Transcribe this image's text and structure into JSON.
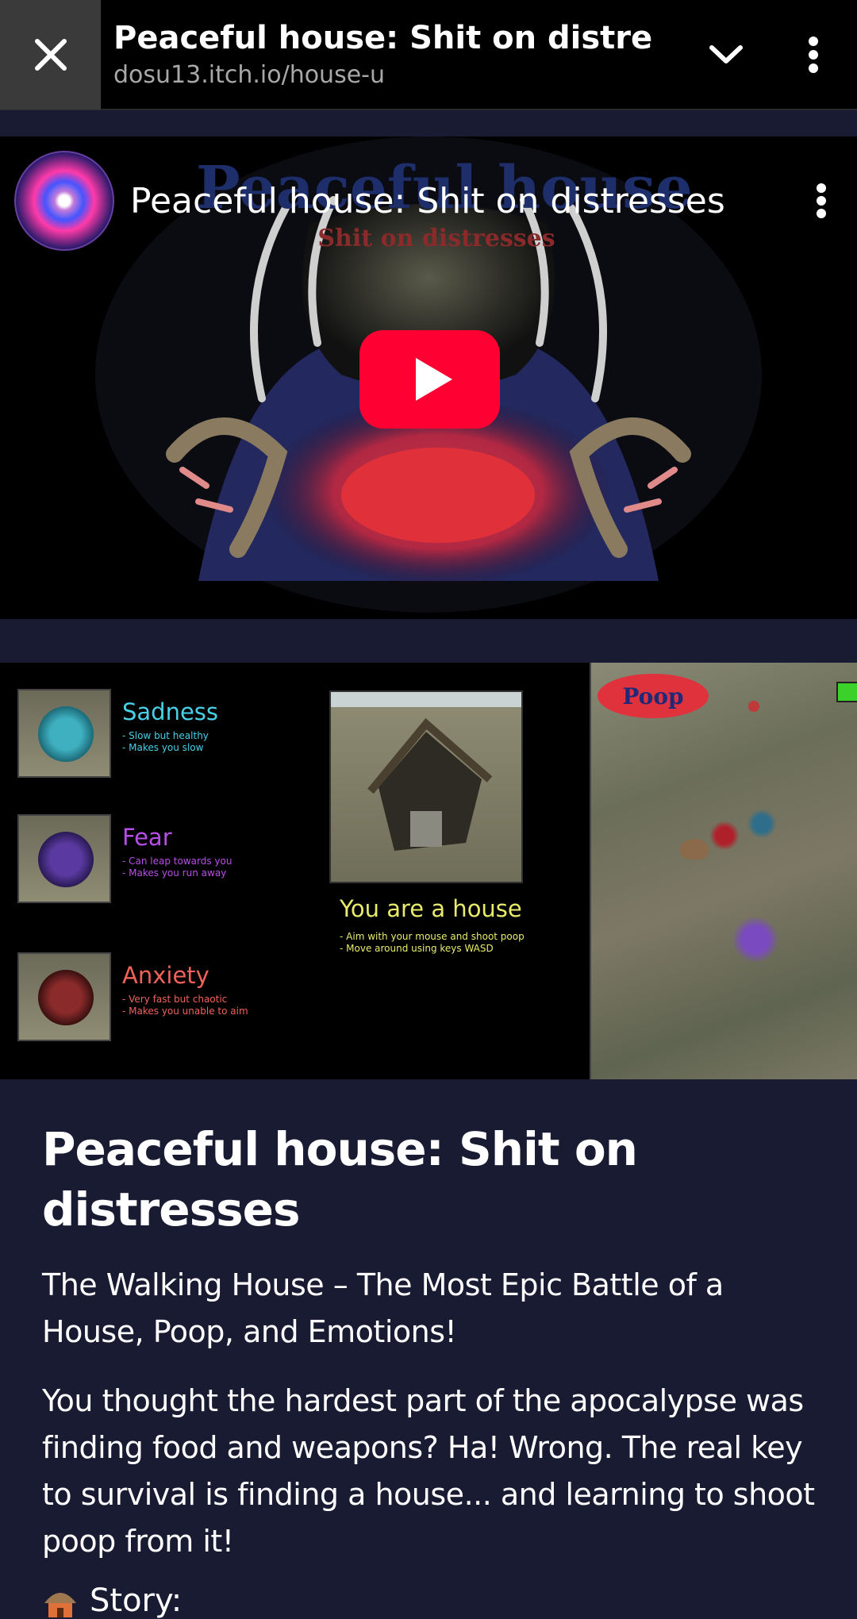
{
  "browser": {
    "title": "Peaceful house: Shit on distresses",
    "url": "dosu13.itch.io/house-u"
  },
  "video": {
    "title": "Peaceful house: Shit on distresses",
    "thumbnail_title": "Peaceful house",
    "thumbnail_subtitle": "Shit on distresses"
  },
  "gallery": {
    "enemies": [
      {
        "name": "Sadness",
        "lines": [
          "- Slow but healthy",
          "- Makes you slow"
        ],
        "color": "#48d0e8"
      },
      {
        "name": "Fear",
        "lines": [
          "- Can leap towards you",
          "- Makes you run away"
        ],
        "color": "#b74ee8"
      },
      {
        "name": "Anxiety",
        "lines": [
          "- Very fast but chaotic",
          "- Makes you unable to aim"
        ],
        "color": "#f0625a"
      }
    ],
    "house_title": "You are a house",
    "house_lines": [
      "- Aim with your mouse and shoot poop",
      "- Move around using keys WASD"
    ],
    "poop_label": "Poop"
  },
  "article": {
    "heading": "Peaceful house: Shit on distresses",
    "intro": "The Walking House – The Most Epic Battle of a House, Poop, and Emotions!",
    "body": "You thought the hardest part of the apocalypse was finding food and weapons? Ha! Wrong. The real key to survival is finding a house... and learning to shoot poop from it!",
    "story_label": "Story:"
  }
}
